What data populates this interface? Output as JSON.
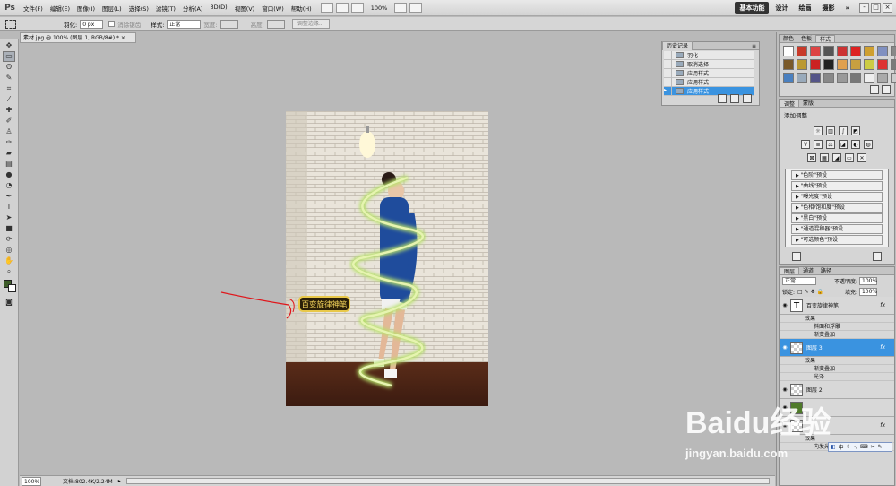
{
  "app": {
    "logo": "Ps"
  },
  "menu": [
    "文件(F)",
    "编辑(E)",
    "图像(I)",
    "图层(L)",
    "选择(S)",
    "滤镜(T)",
    "分析(A)",
    "3D(D)",
    "视图(V)",
    "窗口(W)",
    "帮助(H)"
  ],
  "zoom_level": "100%",
  "workspaces": [
    "基本功能",
    "设计",
    "绘画",
    "摄影"
  ],
  "workspace_active": "基本功能",
  "window_buttons": [
    "-",
    "□",
    "×"
  ],
  "options": {
    "feather_label": "羽化:",
    "feather_value": "0 px",
    "antialias_label": "消除锯齿",
    "style_label": "样式:",
    "style_value": "正常",
    "width_label": "宽度:",
    "height_label": "高度:",
    "refine_edge": "调整边缘..."
  },
  "document": {
    "tab": "素材.jpg @ 100% (图层 1, RGB/8#) * ×",
    "status_zoom": "100%",
    "doc_info": "文档:802.4K/2.24M"
  },
  "canvas_text": "百变旋律神笔",
  "history": {
    "title": "历史记录",
    "rows": [
      "羽化",
      "取消选择",
      "应用样式",
      "应用样式",
      "应用样式"
    ],
    "selected_index": 4
  },
  "styles_panel": {
    "tabs": [
      "颜色",
      "色板",
      "样式"
    ],
    "active_tab": "样式"
  },
  "adjust_panel": {
    "tabs": [
      "调整",
      "蒙版"
    ],
    "heading": "添加调整",
    "presets": [
      "\"色阶\"预设",
      "\"曲线\"预设",
      "\"曝光度\"预设",
      "\"色相/饱和度\"预设",
      "\"黑白\"预设",
      "\"通道混和器\"预设",
      "\"可选颜色\"预设"
    ]
  },
  "layers_panel": {
    "tabs": [
      "图层",
      "通道",
      "路径"
    ],
    "blend_mode": "正常",
    "opacity_label": "不透明度:",
    "opacity_value": "100%",
    "lock_label": "锁定:",
    "fill_label": "填充:",
    "fill_value": "100%",
    "fx_label": "fx",
    "layers": [
      {
        "name": "百变旋律神笔",
        "type": "text",
        "effects_label": "效果",
        "effects": [
          "斜面和浮雕",
          "渐变叠加"
        ]
      },
      {
        "name": "图层 3",
        "type": "pixel",
        "selected": true,
        "effects_label": "效果",
        "effects": [
          "渐变叠加",
          "光泽"
        ]
      },
      {
        "name": "图层 2",
        "type": "pixel"
      },
      {
        "name": "",
        "type": "photo"
      },
      {
        "name": "",
        "type": "pixel",
        "effects_label": "效果",
        "effects": [
          "内发光"
        ]
      }
    ]
  },
  "ime_bar": "中",
  "watermark": {
    "logo": "Baidu经验",
    "url": "jingyan.baidu.com"
  },
  "colors": {
    "selection_blue": "#3a93e0",
    "spiral_green": "#b7e06a",
    "floor_brown": "#4a2416",
    "jacket_blue": "#1f4c9c",
    "annotation_red": "#e0161b"
  }
}
